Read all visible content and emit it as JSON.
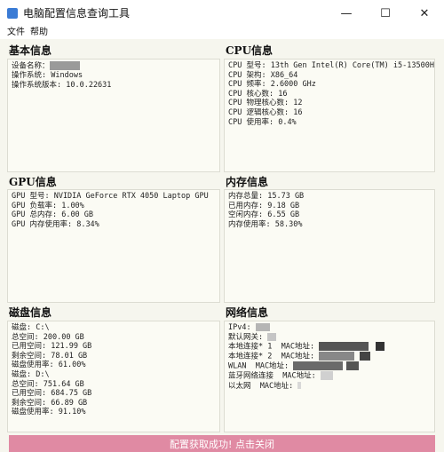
{
  "window": {
    "title": "电脑配置信息查询工具",
    "min": "—",
    "max": "☐",
    "close": "✕"
  },
  "menu": {
    "file": "文件",
    "help": "帮助"
  },
  "basic": {
    "heading": "基本信息",
    "lines": [
      "设备名称：",
      "操作系统: Windows",
      "操作系统版本: 10.0.22631"
    ]
  },
  "cpu": {
    "heading": "CPU信息",
    "lines": [
      "CPU 型号: 13th Gen Intel(R) Core(TM) i5-13500H",
      "CPU 架构: X86_64",
      "CPU 频率: 2.6000 GHz",
      "CPU 核心数: 16",
      "CPU 物理核心数: 12",
      "CPU 逻辑核心数: 16",
      "CPU 使用率: 0.4%"
    ]
  },
  "gpu": {
    "heading": "GPU信息",
    "lines": [
      "GPU 型号: NVIDIA GeForce RTX 4050 Laptop GPU",
      "GPU 负载率: 1.00%",
      "GPU 总内存: 6.00 GB",
      "GPU 内存使用率: 8.34%"
    ]
  },
  "memory": {
    "heading": "内存信息",
    "lines": [
      "内存总量: 15.73 GB",
      "已用内存: 9.18 GB",
      "空闲内存: 6.55 GB",
      "内存使用率: 58.30%"
    ]
  },
  "disk": {
    "heading": "磁盘信息",
    "lines": [
      "磁盘: C:\\",
      "总空间: 200.00 GB",
      "已用空间: 121.99 GB",
      "剩余空间: 78.01 GB",
      "磁盘使用率: 61.00%",
      "",
      "磁盘: D:\\",
      "总空间: 751.64 GB",
      "已用空间: 684.75 GB",
      "剩余空间: 66.89 GB",
      "磁盘使用率: 91.10%"
    ]
  },
  "network": {
    "heading": "网络信息",
    "lines": [
      "IPv4: ",
      "默认网关: ",
      "本地连接* 1  MAC地址: ",
      "本地连接* 2  MAC地址: ",
      "WLAN  MAC地址: ",
      "蓝牙网络连接  MAC地址: ",
      "以太网  MAC地址: "
    ]
  },
  "status": "配置获取成功! 点击关闭"
}
